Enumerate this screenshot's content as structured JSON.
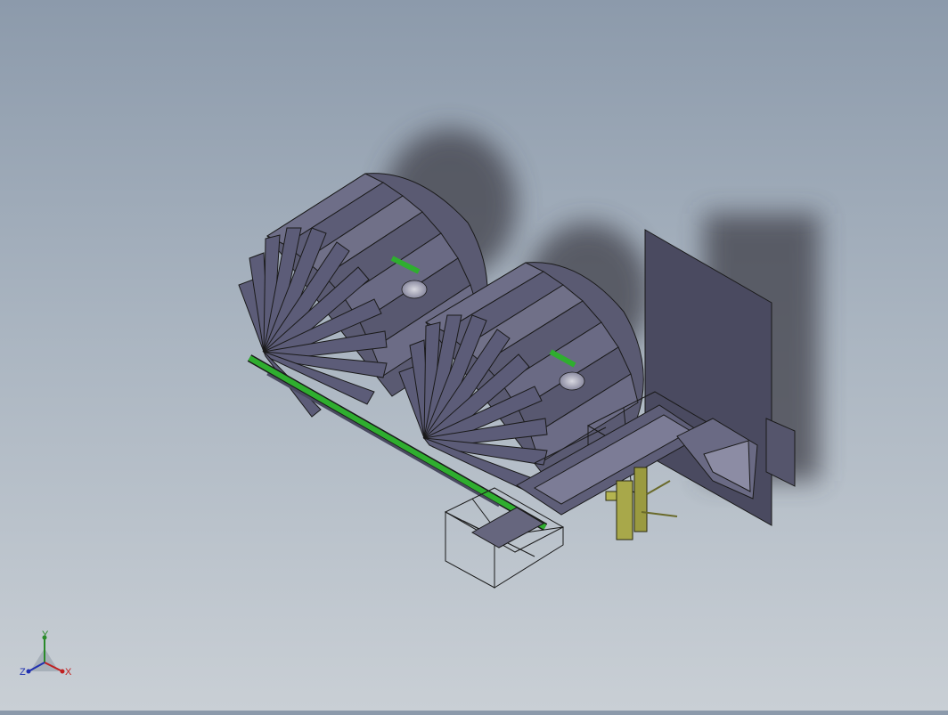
{
  "viewport": {
    "background_top": "#8c9aab",
    "background_bottom": "#c9cfd5",
    "model_colors": {
      "body": "#5a5a72",
      "body_dark": "#3a3a50",
      "shaft": "#2fae2f",
      "rack": "#a8a84a",
      "shadow": "#3f3f48",
      "wireframe": "#1a1a1a"
    }
  },
  "triad": {
    "x_label": "X",
    "y_label": "Y",
    "z_label": "Z",
    "x_color": "#c02020",
    "y_color": "#2a8a2a",
    "z_color": "#2030b0"
  }
}
